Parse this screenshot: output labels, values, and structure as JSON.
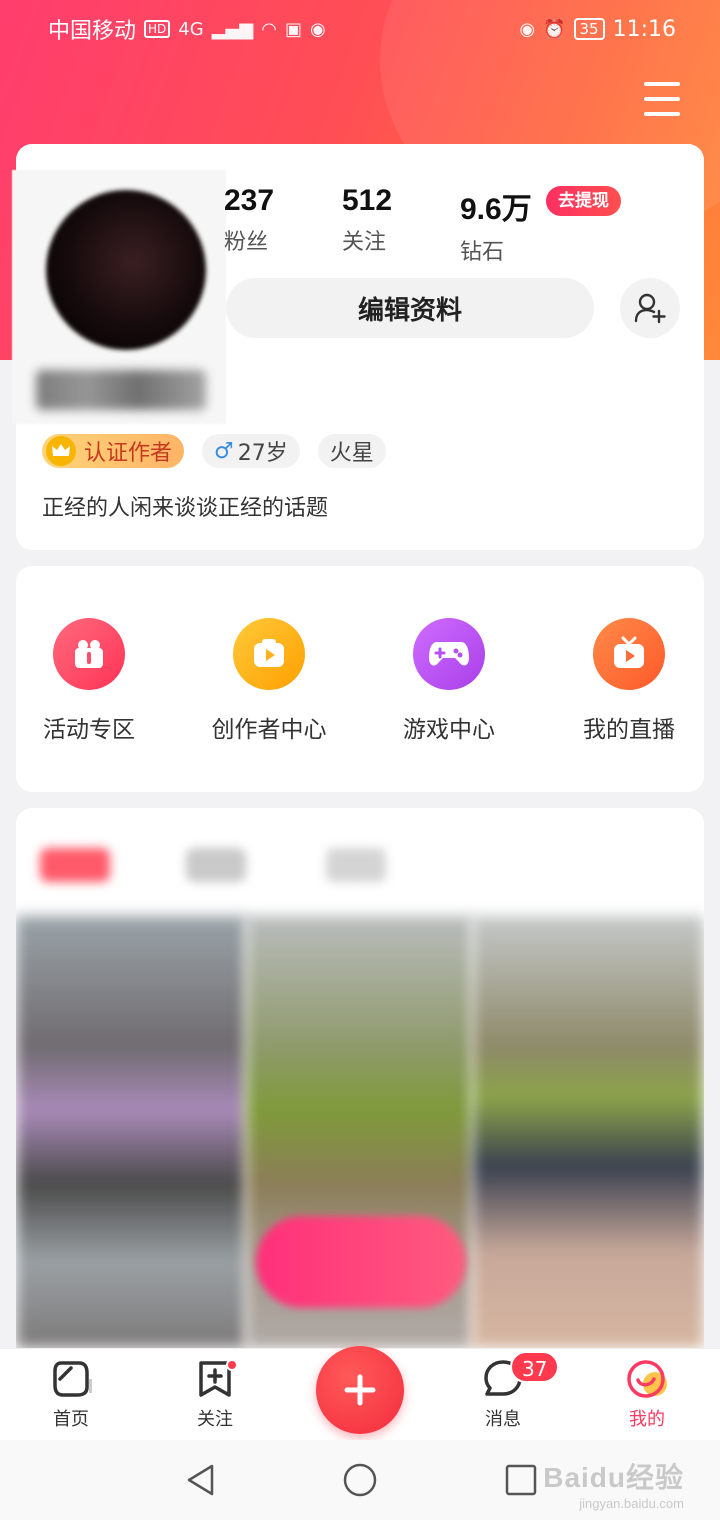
{
  "status_bar": {
    "carrier": "中国移动",
    "hd": "HD",
    "network": "4G",
    "battery": "35",
    "time": "11:16"
  },
  "profile": {
    "stats": [
      {
        "value": "237",
        "label": "粉丝"
      },
      {
        "value": "512",
        "label": "关注"
      },
      {
        "value": "9.6万",
        "label": "钻石"
      }
    ],
    "withdraw_label": "去提现",
    "edit_label": "编辑资料",
    "tags": {
      "cert": "认证作者",
      "gender_symbol": "♂",
      "age": "27岁",
      "zodiac": "火星"
    },
    "bio": "正经的人闲来谈谈正经的话题"
  },
  "features": [
    {
      "label": "活动专区",
      "icon": "gift-icon",
      "color": "#ff4d6d"
    },
    {
      "label": "创作者中心",
      "icon": "creator-play-icon",
      "color": "#ffb21a"
    },
    {
      "label": "游戏中心",
      "icon": "gamepad-icon",
      "color": "#b84ff0"
    },
    {
      "label": "我的直播",
      "icon": "tv-live-icon",
      "color": "#ff6a3a"
    }
  ],
  "bottom_nav": {
    "home": "首页",
    "follow": "关注",
    "messages": "消息",
    "messages_badge": "37",
    "mine": "我的"
  },
  "watermark": {
    "main": "Baidu经验",
    "sub": "jingyan.baidu.com"
  },
  "colors": {
    "accent": "#ff3a62",
    "header_start": "#ff3d6e",
    "header_end": "#ff8a3a"
  }
}
